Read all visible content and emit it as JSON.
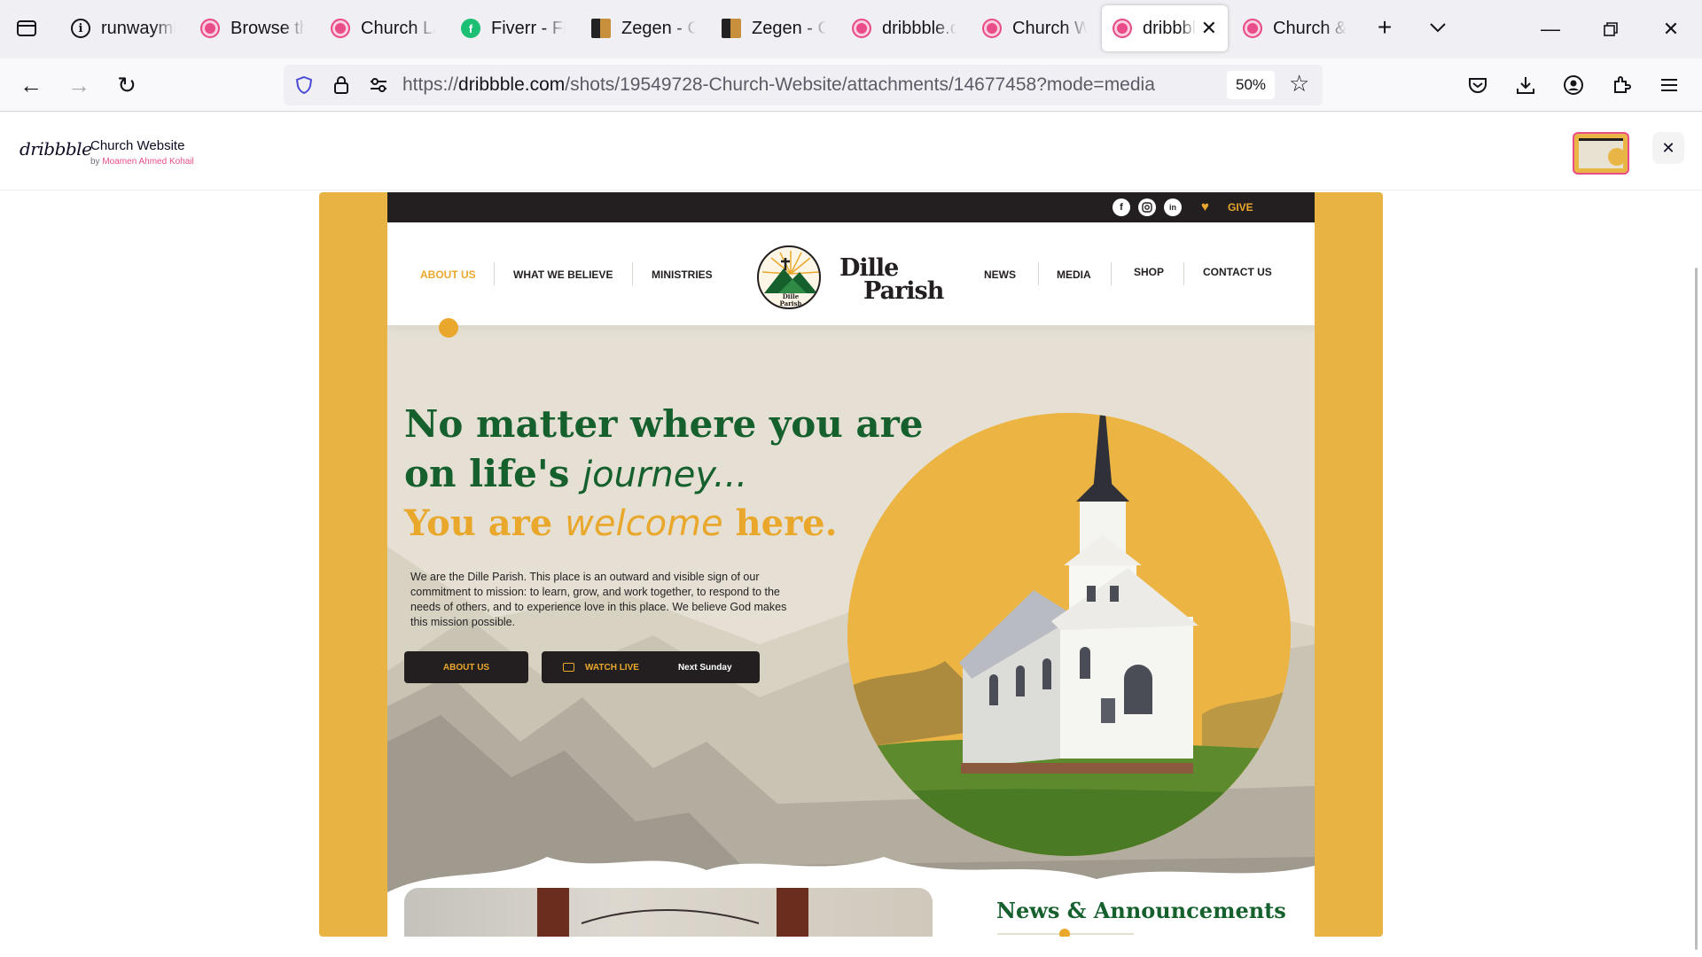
{
  "browser": {
    "tabs": [
      {
        "label": "runwayml",
        "icon": "info-icon"
      },
      {
        "label": "Browse the",
        "icon": "dribbble-icon"
      },
      {
        "label": "Church La",
        "icon": "dribbble-icon"
      },
      {
        "label": "Fiverr - Fre",
        "icon": "fiverr-icon"
      },
      {
        "label": "Zegen - Cl",
        "icon": "zegen-icon"
      },
      {
        "label": "Zegen - Cl",
        "icon": "zegen-icon"
      },
      {
        "label": "dribbble.c",
        "icon": "dribbble-icon"
      },
      {
        "label": "Church We",
        "icon": "dribbble-icon"
      },
      {
        "label": "dribbbl",
        "icon": "dribbble-icon",
        "active": true
      },
      {
        "label": "Church &",
        "icon": "dribbble-icon"
      }
    ],
    "url": {
      "scheme": "https://",
      "host": "dribbble.com",
      "path": "/shots/19549728-Church-Website/attachments/14677458?mode=media"
    },
    "zoom": "50%"
  },
  "viewer": {
    "logo": "dribbble",
    "title": "Church Website",
    "by_prefix": "by",
    "author": "Moamen Ahmed Kohail"
  },
  "site": {
    "give_label": "GIVE",
    "social": [
      "f",
      "ig",
      "in"
    ],
    "nav_left": [
      "ABOUT US",
      "WHAT WE BELIEVE",
      "MINISTRIES"
    ],
    "nav_right": [
      "NEWS",
      "MEDIA",
      "SHOP",
      "CONTACT US"
    ],
    "brand": {
      "line1": "Dille",
      "line2": "Parish",
      "crest_line1": "Dille",
      "crest_line2": "Parish"
    },
    "hero": {
      "line1": "No matter where you are",
      "line2_prefix": "on life's",
      "line2_script": "journey...",
      "line3_prefix": "You are",
      "line3_script": "welcome",
      "line3_suffix": "here.",
      "intro": "We are the Dille Parish. This place is an outward and visible sign of our commitment to mission: to learn, grow, and work together, to respond to the needs of others, and to experience love in this place. We believe God makes this mission possible.",
      "btn_about": "ABOUT US",
      "btn_live": "WATCH LIVE",
      "btn_live_sub": "Next Sunday"
    },
    "news_heading": "News & Announcements"
  },
  "colors": {
    "accent_gold": "#e9a82b",
    "brand_green": "#16602e",
    "dark": "#231f20",
    "dribbble_pink": "#ea4c89"
  }
}
